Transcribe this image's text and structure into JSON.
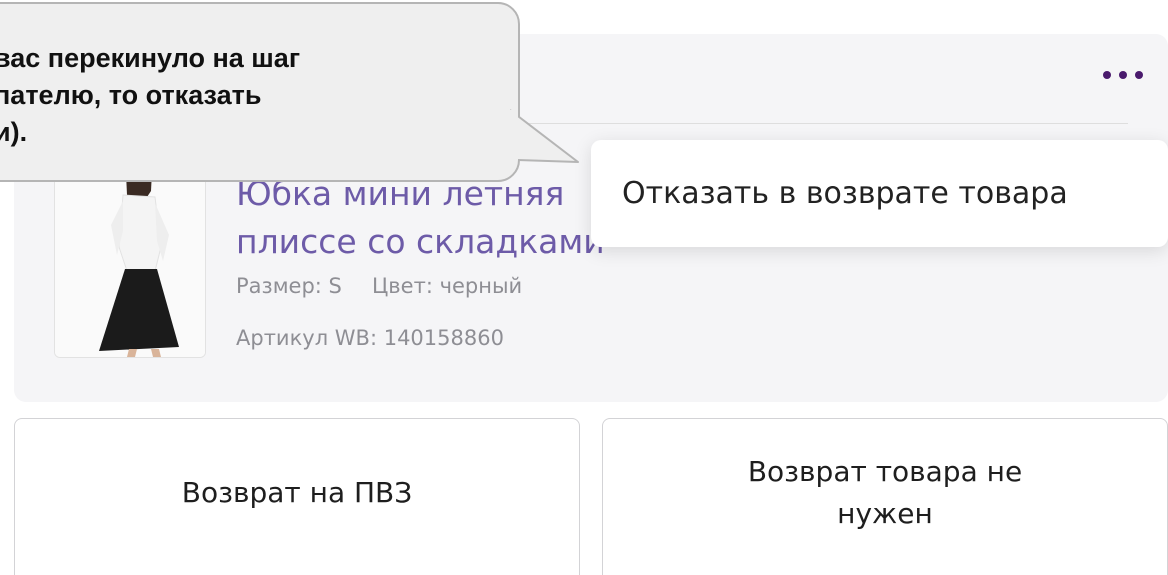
{
  "card": {
    "product_title": "Юбка мини летняя плиссе со складками",
    "size_text": "Размер: S",
    "color_text": "Цвет: черный",
    "sku_text": "Артикул WB: 140158860"
  },
  "menu": {
    "items": [
      "Отказать в возврате товара"
    ]
  },
  "hint_bubble": {
    "lines": [
      "вас перекинуло на шаг",
      "пателю, то отказать",
      "и)."
    ]
  },
  "actions": {
    "return_to_pickup_label": "Возврат на ПВЗ",
    "return_not_needed_label": "Возврат товара не нужен"
  },
  "colors": {
    "accent_dots": "#4a1a6d",
    "title_link": "#6d5ba8",
    "card_bg": "#f5f5f7",
    "meta_text": "#8e8e94"
  },
  "icons": {
    "more": "more-dots-icon"
  }
}
